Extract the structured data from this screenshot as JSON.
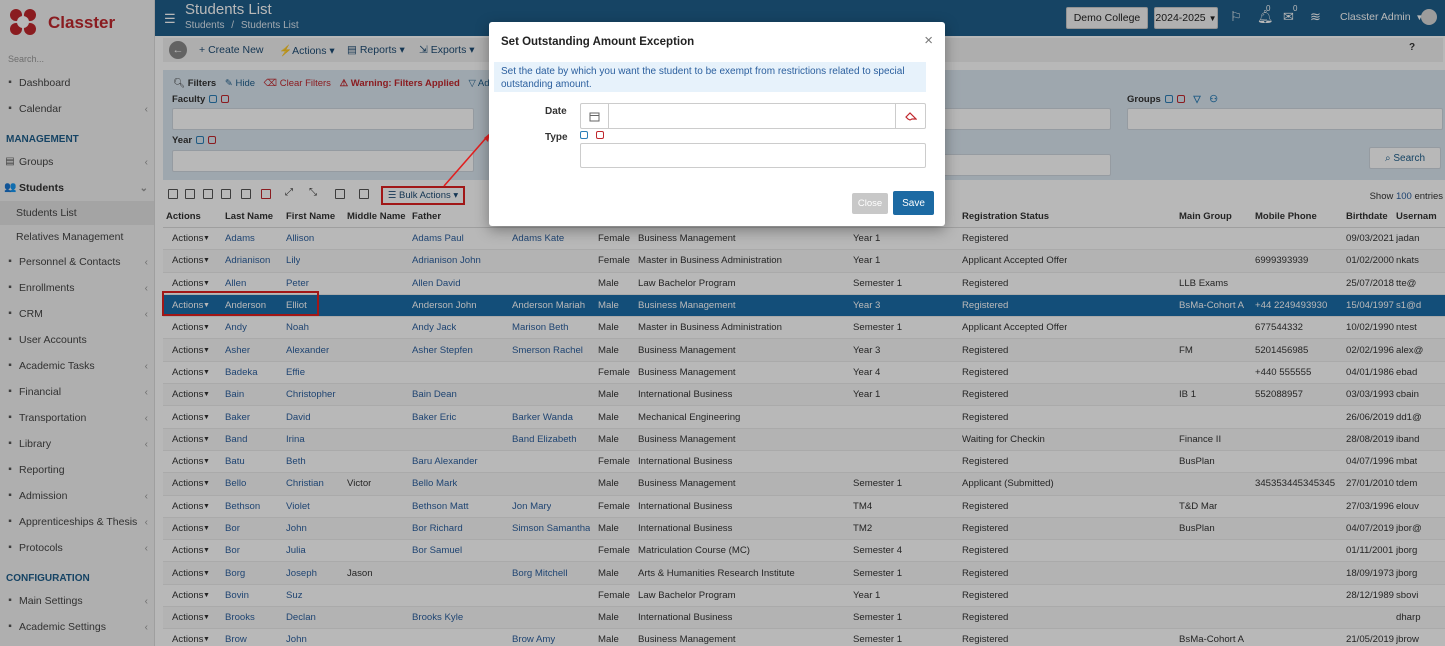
{
  "app": {
    "brand": "Classter",
    "colors": {
      "primary": "#1f5f8b",
      "accent": "#c0272d",
      "highlight": "#e02020"
    }
  },
  "sidebar": {
    "search_placeholder": "Search...",
    "items_top": [
      {
        "label": "Dashboard",
        "icon": "monitor-icon"
      },
      {
        "label": "Calendar",
        "icon": "calendar-icon",
        "chevron": true
      }
    ],
    "section_management": "MANAGEMENT",
    "groups": "Groups",
    "students": "Students",
    "students_list": "Students List",
    "relatives": "Relatives Management",
    "items_mid": [
      {
        "label": "Personnel & Contacts",
        "icon": "people-icon",
        "chevron": true
      },
      {
        "label": "Enrollments",
        "icon": "enroll-icon",
        "chevron": true
      },
      {
        "label": "CRM",
        "icon": "crm-icon",
        "chevron": true
      },
      {
        "label": "User Accounts",
        "icon": "key-icon",
        "chevron": false
      },
      {
        "label": "Academic Tasks",
        "icon": "tasks-icon",
        "chevron": true
      },
      {
        "label": "Financial",
        "icon": "financial-icon",
        "chevron": true
      },
      {
        "label": "Transportation",
        "icon": "bus-icon",
        "chevron": true
      },
      {
        "label": "Library",
        "icon": "library-icon",
        "chevron": true
      },
      {
        "label": "Reporting",
        "icon": "reporting-icon",
        "chevron": false
      },
      {
        "label": "Admission",
        "icon": "admission-icon",
        "chevron": true
      },
      {
        "label": "Apprenticeships & Thesis",
        "icon": "thesis-icon",
        "chevron": true
      },
      {
        "label": "Protocols",
        "icon": "protocols-icon",
        "chevron": true
      }
    ],
    "section_configuration": "CONFIGURATION",
    "items_bottom": [
      {
        "label": "Main Settings",
        "icon": "settings-icon",
        "chevron": true
      },
      {
        "label": "Academic Settings",
        "icon": "academic-settings-icon",
        "chevron": true
      }
    ]
  },
  "header": {
    "title": "Students List",
    "breadcrumb_root": "Students",
    "breadcrumb_sep": "/",
    "breadcrumb_current": "Students List",
    "college": "Demo College",
    "year": "2024-2025",
    "notif_count": "0",
    "msg_count": "0",
    "user": "Classter Admin"
  },
  "toolbar": {
    "create_new": "Create New",
    "actions": "Actions",
    "reports": "Reports",
    "exports": "Exports",
    "help": "?"
  },
  "filters": {
    "title": "Filters",
    "hide": "Hide",
    "clear": "Clear Filters",
    "warning": "Warning: Filters Applied",
    "advanced": "Advanced",
    "faculty": "Faculty",
    "year": "Year",
    "groups": "Groups",
    "search": "Search"
  },
  "gridbar": {
    "bulk": "Bulk Actions",
    "show_label": "Show",
    "show_value": "100",
    "entries": "entries"
  },
  "table": {
    "columns": {
      "actions": "Actions",
      "last_name": "Last Name",
      "first_name": "First Name",
      "middle_name": "Middle Name",
      "father": "Father",
      "mother": "",
      "gender": "",
      "program": "",
      "period": "",
      "registration_status": "Registration Status",
      "main_group": "Main Group",
      "mobile_phone": "Mobile Phone",
      "birthdate": "Birthdate",
      "username": "Usernam"
    },
    "actions_label": "Actions",
    "rows": [
      {
        "last": "Adams",
        "first": "Allison",
        "middle": "",
        "father": "Adams Paul",
        "mother": "Adams Kate",
        "gender": "Female",
        "program": "Business Management",
        "period": "Year 1",
        "status": "Registered",
        "group": "",
        "phone": "",
        "birth": "09/03/2021",
        "user": "jadan"
      },
      {
        "last": "Adrianison",
        "first": "Lily",
        "middle": "",
        "father": "Adrianison John",
        "mother": "",
        "gender": "Female",
        "program": "Master in Business Administration",
        "period": "Year 1",
        "status": "Applicant Accepted Offer",
        "group": "",
        "phone": "6999393939",
        "birth": "01/02/2000",
        "user": "nkats"
      },
      {
        "last": "Allen",
        "first": "Peter",
        "middle": "",
        "father": "Allen David",
        "mother": "",
        "gender": "Male",
        "program": "Law Bachelor Program",
        "period": "Semester 1",
        "status": "Registered",
        "group": "LLB Exams",
        "phone": "",
        "birth": "25/07/2018",
        "user": "tte@"
      },
      {
        "last": "Anderson",
        "first": "Elliot",
        "middle": "",
        "father": "Anderson John",
        "mother": "Anderson Mariah",
        "gender": "Male",
        "program": "Business Management",
        "period": "Year 3",
        "status": "Registered",
        "group": "BsMa-Cohort A",
        "phone": "+44 2249493930",
        "birth": "15/04/1997",
        "user": "s1@d",
        "selected": true
      },
      {
        "last": "Andy",
        "first": "Noah",
        "middle": "",
        "father": "Andy Jack",
        "mother": "Marison Beth",
        "gender": "Male",
        "program": "Master in Business Administration",
        "period": "Semester 1",
        "status": "Applicant Accepted Offer",
        "group": "",
        "phone": "677544332",
        "birth": "10/02/1990",
        "user": "ntest"
      },
      {
        "last": "Asher",
        "first": "Alexander",
        "middle": "",
        "father": "Asher Stepfen",
        "mother": "Smerson Rachel",
        "gender": "Male",
        "program": "Business Management",
        "period": "Year 3",
        "status": "Registered",
        "group": "FM",
        "phone": "5201456985",
        "birth": "02/02/1996",
        "user": "alex@"
      },
      {
        "last": "Badeka",
        "first": "Effie",
        "middle": "",
        "father": "",
        "mother": "",
        "gender": "Female",
        "program": "Business Management",
        "period": "Year 4",
        "status": "Registered",
        "group": "",
        "phone": "+440 555555",
        "birth": "04/01/1986",
        "user": "ebad"
      },
      {
        "last": "Bain",
        "first": "Christopher",
        "middle": "",
        "father": "Bain Dean",
        "mother": "",
        "gender": "Male",
        "program": "International Business",
        "period": "Year 1",
        "status": "Registered",
        "group": "IB 1",
        "phone": "552088957",
        "birth": "03/03/1993",
        "user": "cbain"
      },
      {
        "last": "Baker",
        "first": "David",
        "middle": "",
        "father": "Baker Eric",
        "mother": "Barker Wanda",
        "gender": "Male",
        "program": "Mechanical Engineering",
        "period": "",
        "status": "Registered",
        "group": "",
        "phone": "",
        "birth": "26/06/2019",
        "user": "dd1@"
      },
      {
        "last": "Band",
        "first": "Irina",
        "middle": "",
        "father": "",
        "mother": "Band Elizabeth",
        "gender": "Male",
        "program": "Business Management",
        "period": "",
        "status": "Waiting for Checkin",
        "group": "Finance II",
        "phone": "",
        "birth": "28/08/2019",
        "user": "iband"
      },
      {
        "last": "Batu",
        "first": "Beth",
        "middle": "",
        "father": "Baru Alexander",
        "mother": "",
        "gender": "Female",
        "program": "International Business",
        "period": "",
        "status": "Registered",
        "group": "BusPlan",
        "phone": "",
        "birth": "04/07/1996",
        "user": "mbat"
      },
      {
        "last": "Bello",
        "first": "Christian",
        "middle": "Victor",
        "father": "Bello Mark",
        "mother": "",
        "gender": "Male",
        "program": "Business Management",
        "period": "Semester 1",
        "status": "Applicant (Submitted)",
        "group": "",
        "phone": "345353445345345",
        "birth": "27/01/2010",
        "user": "tdem"
      },
      {
        "last": "Bethson",
        "first": "Violet",
        "middle": "",
        "father": "Bethson Matt",
        "mother": "Jon Mary",
        "gender": "Female",
        "program": "International Business",
        "period": "TM4",
        "status": "Registered",
        "group": "T&D Mar",
        "phone": "",
        "birth": "27/03/1996",
        "user": "elouv"
      },
      {
        "last": "Bor",
        "first": "John",
        "middle": "",
        "father": "Bor Richard",
        "mother": "Simson Samantha",
        "gender": "Male",
        "program": "International Business",
        "period": "TM2",
        "status": "Registered",
        "group": "BusPlan",
        "phone": "",
        "birth": "04/07/2019",
        "user": "jbor@"
      },
      {
        "last": "Bor",
        "first": "Julia",
        "middle": "",
        "father": "Bor Samuel",
        "mother": "",
        "gender": "Female",
        "program": "Matriculation Course (MC)",
        "period": "Semester 4",
        "status": "Registered",
        "group": "",
        "phone": "",
        "birth": "01/11/2001",
        "user": "jborg"
      },
      {
        "last": "Borg",
        "first": "Joseph",
        "middle": "Jason",
        "father": "",
        "mother": "Borg Mitchell",
        "gender": "Male",
        "program": "Arts & Humanities Research Institute",
        "period": "Semester 1",
        "status": "Registered",
        "group": "",
        "phone": "",
        "birth": "18/09/1973",
        "user": "jborg"
      },
      {
        "last": "Bovin",
        "first": "Suz",
        "middle": "",
        "father": "",
        "mother": "",
        "gender": "Female",
        "program": "Law Bachelor Program",
        "period": "Year 1",
        "status": "Registered",
        "group": "",
        "phone": "",
        "birth": "28/12/1989",
        "user": "sbovi"
      },
      {
        "last": "Brooks",
        "first": "Declan",
        "middle": "",
        "father": "Brooks Kyle",
        "mother": "",
        "gender": "Male",
        "program": "International Business",
        "period": "Semester 1",
        "status": "Registered",
        "group": "",
        "phone": "",
        "birth": "",
        "user": "dharp"
      },
      {
        "last": "Brow",
        "first": "John",
        "middle": "",
        "father": "",
        "mother": "Brow Amy",
        "gender": "Male",
        "program": "Business Management",
        "period": "Semester 1",
        "status": "Registered",
        "group": "BsMa-Cohort A",
        "phone": "",
        "birth": "21/05/2019",
        "user": "jbrow"
      }
    ]
  },
  "modal": {
    "title": "Set Outstanding Amount Exception",
    "info": "Set the date by which you want the student to be exempt from restrictions related to special outstanding amount.",
    "date_label": "Date",
    "type_label": "Type",
    "close": "Close",
    "save": "Save"
  }
}
